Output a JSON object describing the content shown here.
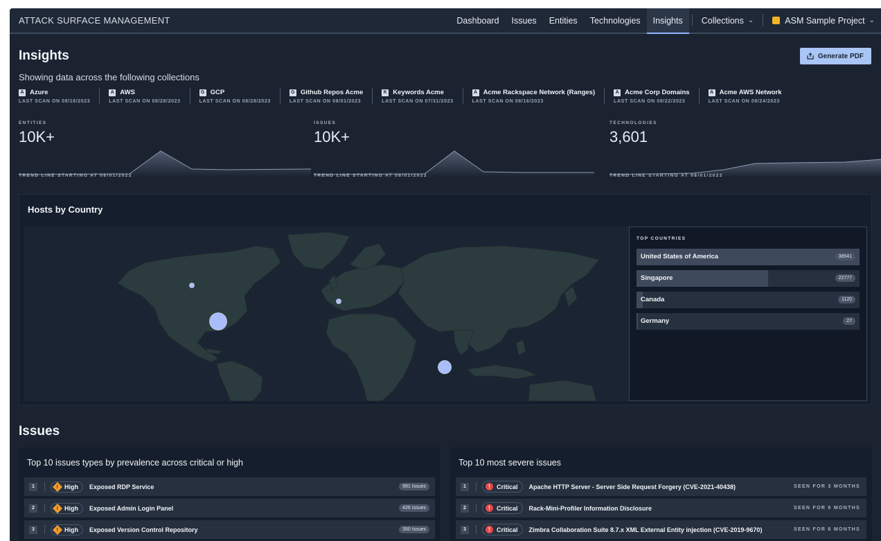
{
  "header": {
    "brand": "ATTACK SURFACE MANAGEMENT",
    "nav": [
      "Dashboard",
      "Issues",
      "Entities",
      "Technologies",
      "Insights"
    ],
    "active_nav": "Insights",
    "collections_label": "Collections",
    "project_label": "ASM Sample Project"
  },
  "page": {
    "title": "Insights",
    "generate_pdf": "Generate PDF",
    "subtitle": "Showing data across the following collections"
  },
  "collections": [
    {
      "badge": "A",
      "name": "Azure",
      "scan": "LAST SCAN ON 08/16/2023"
    },
    {
      "badge": "A",
      "name": "AWS",
      "scan": "LAST SCAN ON 08/28/2023"
    },
    {
      "badge": "G",
      "name": "GCP",
      "scan": "LAST SCAN ON 08/28/2023"
    },
    {
      "badge": "G",
      "name": "Github Repos Acme",
      "scan": "LAST SCAN ON 08/01/2023"
    },
    {
      "badge": "K",
      "name": "Keywords Acme",
      "scan": "LAST SCAN ON 07/31/2023"
    },
    {
      "badge": "A",
      "name": "Acme Rackspace Network (Ranges)",
      "scan": "LAST SCAN ON 08/16/2023"
    },
    {
      "badge": "A",
      "name": "Acme Corp Domains",
      "scan": "LAST SCAN ON 08/22/2023"
    },
    {
      "badge": "A",
      "name": "Acme AWS Network",
      "scan": "LAST SCAN ON 08/24/2023"
    }
  ],
  "stats": [
    {
      "label": "ENTITIES",
      "value": "10K+",
      "trend": "TREND LINE STARTING AT 08/01/2022"
    },
    {
      "label": "ISSUES",
      "value": "10K+",
      "trend": "TREND LINE STARTING AT 08/01/2022"
    },
    {
      "label": "TECHNOLOGIES",
      "value": "3,601",
      "trend": "TREND LINE STARTING AT 08/01/2022"
    }
  ],
  "hosts_by_country": {
    "title": "Hosts by Country",
    "top_label": "TOP COUNTRIES",
    "countries": [
      {
        "name": "United States of America",
        "count": 38541
      },
      {
        "name": "Singapore",
        "count": 22777
      },
      {
        "name": "Canada",
        "count": 1120
      },
      {
        "name": "Germany",
        "count": 27
      }
    ]
  },
  "issues": {
    "title": "Issues",
    "prevalence": {
      "title": "Top 10 issues types by prevalence across critical or high",
      "rows": [
        {
          "num": "1",
          "severity": "High",
          "title": "Exposed RDP Service",
          "count": "991 Issues"
        },
        {
          "num": "2",
          "severity": "High",
          "title": "Exposed Admin Login Panel",
          "count": "426 Issues"
        },
        {
          "num": "3",
          "severity": "High",
          "title": "Exposed Version Control Repository",
          "count": "350 Issues"
        }
      ]
    },
    "severe": {
      "title": "Top 10 most severe issues",
      "rows": [
        {
          "num": "1",
          "severity": "Critical",
          "title": "Apache HTTP Server - Server Side Request Forgery (CVE-2021-40438)",
          "seen": "SEEN FOR 3 MONTHS"
        },
        {
          "num": "2",
          "severity": "Critical",
          "title": "Rack-Mini-Profiler Information Disclosure",
          "seen": "SEEN FOR 6 MONTHS"
        },
        {
          "num": "3",
          "severity": "Critical",
          "title": "Zimbra Collaboration Suite 8.7.x XML External Entity injection (CVE-2019-9670)",
          "seen": "SEEN FOR 6 MONTHS"
        }
      ]
    }
  },
  "colors": {
    "accent": "#a9c6f6",
    "bubble": "#a8bdfa",
    "high": "#ef9b30",
    "critical": "#e34a4a"
  }
}
